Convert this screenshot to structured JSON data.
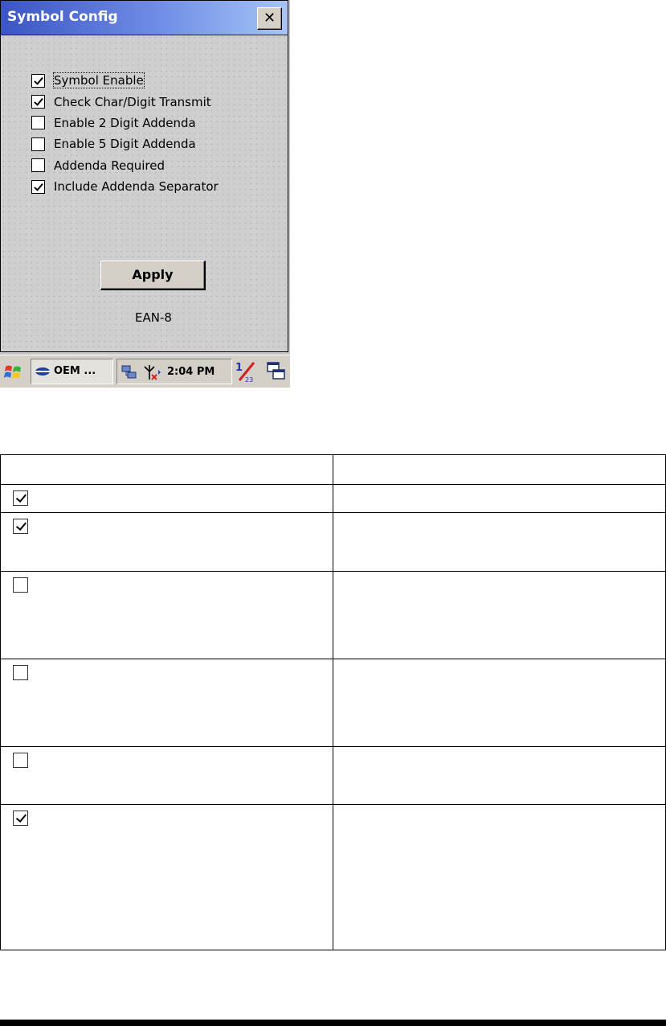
{
  "dialog": {
    "title": "Symbol Config",
    "close_glyph": "✕",
    "options": [
      {
        "label": "Symbol Enable",
        "checked": true
      },
      {
        "label": "Check Char/Digit Transmit",
        "checked": true
      },
      {
        "label": "Enable 2 Digit Addenda",
        "checked": false
      },
      {
        "label": "Enable 5 Digit Addenda",
        "checked": false
      },
      {
        "label": "Addenda Required",
        "checked": false
      },
      {
        "label": "Include Addenda Separator",
        "checked": true
      }
    ],
    "apply_label": "Apply",
    "symbol_name": "EAN-8"
  },
  "taskbar": {
    "start_icon": "windows-flag-icon",
    "app_label": "OEM ...",
    "time": "2:04 PM",
    "tray_icons": [
      "network-icon",
      "antenna-icon",
      "input-panel-icon",
      "windows-switch-icon"
    ]
  },
  "doc_table": {
    "rows": [
      {
        "checked": true
      },
      {
        "checked": true
      },
      {
        "checked": false
      },
      {
        "checked": false
      },
      {
        "checked": false
      },
      {
        "checked": true
      }
    ]
  }
}
